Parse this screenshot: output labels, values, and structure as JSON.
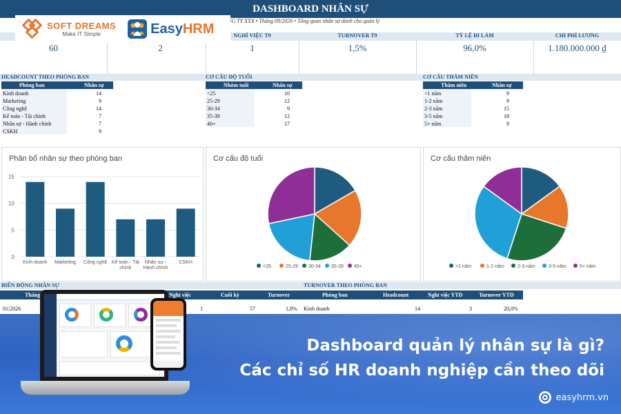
{
  "header": {
    "title": "DASHBOARD NHÂN SỰ",
    "subtitle": "NG TY XXX • Tháng 09/2026 • Tổng quan nhân sự dành cho quản lý"
  },
  "logos": {
    "softdreams_name": "SOFT DREAMS",
    "softdreams_tagline": "Make IT Simple",
    "easyhrm_name_a": "Easy",
    "easyhrm_name_b": "HRM"
  },
  "kpis": [
    {
      "label": "",
      "value": "60"
    },
    {
      "label": "",
      "value": "2"
    },
    {
      "label": "NGHỈ VIỆC T9",
      "value": "1"
    },
    {
      "label": "TURNOVER T9",
      "value": "1,5%"
    },
    {
      "label": "TỶ LỆ ĐI LÀM",
      "value": "96,0%"
    },
    {
      "label": "CHI PHÍ LƯƠNG",
      "value": "1.180.000.000 ₫"
    }
  ],
  "sections": {
    "dept": {
      "title": "HEADCOUNT THEO PHÒNG BAN",
      "col1": "Phòng ban",
      "col2": "Nhân sự",
      "rows": [
        {
          "name": "Kinh doanh",
          "value": "14"
        },
        {
          "name": "Marketing",
          "value": "9"
        },
        {
          "name": "Công nghệ",
          "value": "14"
        },
        {
          "name": "Kế toán - Tài chính",
          "value": "7"
        },
        {
          "name": "Nhân sự - Hành chính",
          "value": "7"
        },
        {
          "name": "CSKH",
          "value": "9"
        }
      ]
    },
    "age": {
      "title": "CƠ CẤU ĐỘ TUỔI",
      "col1": "Nhóm tuổi",
      "col2": "Nhân sự",
      "rows": [
        {
          "name": "<25",
          "value": "10"
        },
        {
          "name": "25-29",
          "value": "12"
        },
        {
          "name": "30-34",
          "value": "9"
        },
        {
          "name": "35-39",
          "value": "12"
        },
        {
          "name": "40+",
          "value": "17"
        }
      ]
    },
    "tenure": {
      "title": "CƠ CẤU THÂM NIÊN",
      "col1": "Thâm niên",
      "col2": "Nhân sự",
      "rows": [
        {
          "name": "<1 năm",
          "value": "9"
        },
        {
          "name": "1-2 năm",
          "value": "9"
        },
        {
          "name": "2-3 năm",
          "value": "15"
        },
        {
          "name": "3-5 năm",
          "value": "18"
        },
        {
          "name": "5+ năm",
          "value": "9"
        }
      ]
    }
  },
  "chart_data": [
    {
      "type": "bar",
      "title": "Phân bổ nhân sự theo phòng ban",
      "categories": [
        "Kinh doanh",
        "Marketing",
        "Công nghệ",
        "Kế toán - Tài chính",
        "Nhân sự - Hành chính",
        "CSKH"
      ],
      "category_lines": [
        [
          "Kinh doanh"
        ],
        [
          "Marketing"
        ],
        [
          "Công nghệ"
        ],
        [
          "Kế toán - Tài",
          "chính"
        ],
        [
          "Nhân sự -",
          "Hành chính"
        ],
        [
          "CSKH"
        ]
      ],
      "values": [
        14,
        9,
        14,
        7,
        7,
        9
      ],
      "yticks": [
        0,
        5,
        10,
        15
      ],
      "ylim": [
        0,
        15
      ],
      "color": "#1f5b7e"
    },
    {
      "type": "pie",
      "title": "Cơ cấu độ tuổi",
      "labels": [
        "<25",
        "25-29",
        "30-34",
        "35-39",
        "40+"
      ],
      "values": [
        10,
        12,
        9,
        12,
        17
      ],
      "colors": [
        "#1f5b7e",
        "#e8772e",
        "#1d6e3a",
        "#21a0d8",
        "#8e2e96"
      ],
      "legend": "bottom"
    },
    {
      "type": "pie",
      "title": "Cơ cấu thâm niên",
      "labels": [
        "<1 năm",
        "1-2 năm",
        "2-3 năm",
        "3-5 năm",
        "5+ năm"
      ],
      "values": [
        9,
        9,
        15,
        18,
        9
      ],
      "colors": [
        "#1f5b7e",
        "#e8772e",
        "#1d6e3a",
        "#21a0d8",
        "#8e2e96"
      ],
      "legend": "bottom"
    }
  ],
  "bottom": {
    "left_title": "BIẾN ĐỘNG NHÂN SỰ",
    "right_title": "TURNOVER THEO PHÒNG BAN",
    "left_head": [
      "Tháng",
      "Nghỉ việc",
      "Cuối kỳ",
      "Turnover"
    ],
    "right_head": [
      "Phòng ban",
      "Headcount",
      "Nghỉ việc YTD",
      "Turnover YTD"
    ],
    "left_row": [
      "01/2026",
      "1",
      "57",
      "1,8%"
    ],
    "right_row": [
      "Kinh doanh",
      "14",
      "3",
      "20,0%"
    ]
  },
  "banner": {
    "line1": "Dashboard quản lý nhân sự là gì?",
    "line2": "Các chỉ số HR doanh nghiệp cần theo dõi",
    "site": "easyhrm.vn"
  }
}
